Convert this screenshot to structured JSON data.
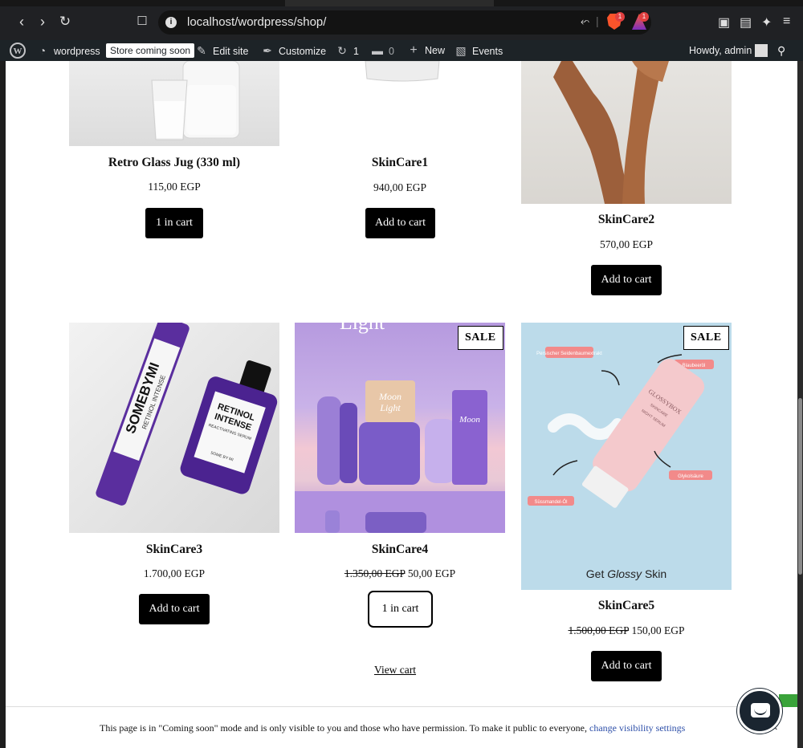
{
  "browser": {
    "url": "localhost/wordpress/shop/",
    "brave_badge": "1",
    "rewards_badge": "1"
  },
  "admin_bar": {
    "site_name": "wordpress",
    "store_badge": "Store coming soon",
    "edit_site": "Edit site",
    "customize": "Customize",
    "updates_count": "1",
    "comments_count": "0",
    "new": "New",
    "events": "Events",
    "greeting": "Howdy, admin"
  },
  "products": [
    {
      "title": "Retro Glass Jug (330 ml)",
      "price": "115,00 EGP",
      "button": "1 in cart"
    },
    {
      "title": "SkinCare1",
      "price": "940,00 EGP",
      "button": "Add to cart"
    },
    {
      "title": "SkinCare2",
      "price": "570,00 EGP",
      "button": "Add to cart"
    },
    {
      "title": "SkinCare3",
      "price": "1.700,00 EGP",
      "button": "Add to cart"
    },
    {
      "title": "SkinCare4",
      "old_price": "1.350,00 EGP",
      "price": "50,00 EGP",
      "button": "1 in cart",
      "badge": "SALE"
    },
    {
      "title": "SkinCare5",
      "old_price": "1.500,00 EGP",
      "price": "150,00 EGP",
      "button": "Add to cart",
      "badge": "SALE"
    }
  ],
  "product_image_text": {
    "skincare3_brand": "SOMEBYMI",
    "skincare3_tube": "RETINOL INTENSE",
    "skincare3_bottle_l1": "RETINOL",
    "skincare3_bottle_l2": "INTENSE",
    "skincare3_bottle_l3": "REACTIVATING SERUM",
    "skincare3_bottle_brand": "SOME BY MI",
    "skincare4_top": "Light",
    "skincare4_moon": "Moon",
    "skincare4_light": "Light",
    "skincare5_tube_brand": "GLOSSYBOX",
    "skincare5_tube_l1": "SKINCARE",
    "skincare5_tube_l2": "NIGHT SERUM",
    "skincare5_label1": "Persischer Seidenbaumextrakt",
    "skincare5_label2": "Blaubeeröl",
    "skincare5_label3": "Glykolsäure",
    "skincare5_label4": "Süssmandel-Öl",
    "skincare5_footer_a": "Get ",
    "skincare5_footer_b": "Glossy",
    "skincare5_footer_c": " Skin"
  },
  "view_cart": "View cart",
  "notice": {
    "text": "This page is in \"Coming soon\" mode and is only visible to you and those who have permission. To make it public to everyone, ",
    "link": "change visibility settings",
    "close": "×"
  },
  "colors": {
    "admin_bar": "#1d2327",
    "button": "#000000",
    "link": "#2c4ea8"
  }
}
